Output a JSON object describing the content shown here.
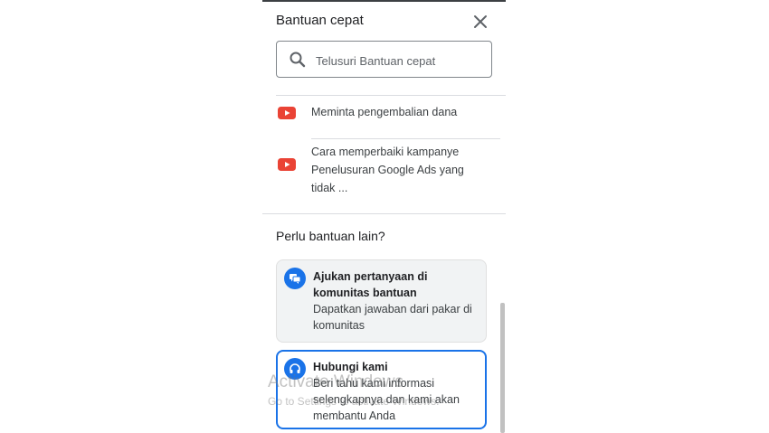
{
  "panel": {
    "title": "Bantuan cepat",
    "search": {
      "placeholder": "Telusuri Bantuan cepat",
      "value": ""
    }
  },
  "articles": [
    {
      "title": "Meminta pengembalian dana",
      "icon": "youtube-icon"
    },
    {
      "title": "Cara memperbaiki kampanye Penelusuran Google Ads yang tidak ...",
      "icon": "youtube-icon",
      "lines": [
        "Cara memperbaiki kampanye",
        "Penelusuran Google Ads yang",
        "tidak ..."
      ]
    }
  ],
  "help": {
    "heading": "Perlu bantuan lain?",
    "cards": [
      {
        "title_lines": [
          "Ajukan pertanyaan di",
          "komunitas bantuan"
        ],
        "desc_lines": [
          "Dapatkan jawaban dari pakar di",
          "komunitas"
        ],
        "icon": "forum-icon"
      },
      {
        "title": "Hubungi kami",
        "desc_lines": [
          "Beri tahu kami informasi",
          "selengkapnya dan kami akan",
          "membantu Anda"
        ],
        "icon": "headset-icon"
      }
    ]
  },
  "overlay": {
    "watermark": "Activate Windows",
    "watermark_sub": "Go to Settings to activate Windows."
  },
  "colors": {
    "accent": "#1a73e8",
    "youtube": "#ea4335",
    "card_bg": "#f1f3f4"
  }
}
